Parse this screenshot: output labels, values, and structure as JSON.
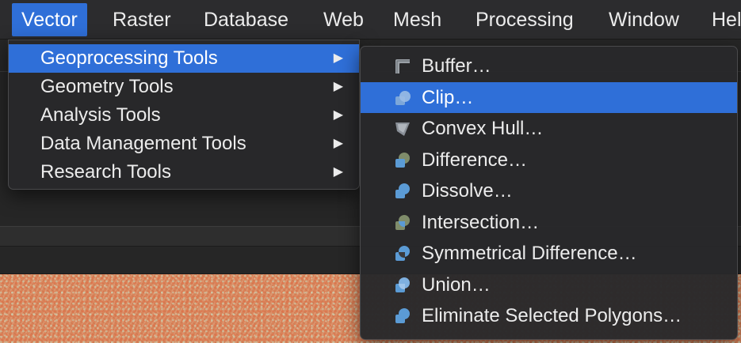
{
  "menubar": {
    "items": [
      {
        "label": "Vector",
        "active": true
      },
      {
        "label": "Raster"
      },
      {
        "label": "Database"
      },
      {
        "label": "Web"
      },
      {
        "label": "Mesh"
      },
      {
        "label": "Processing"
      },
      {
        "label": "Window"
      },
      {
        "label": "Hel"
      }
    ]
  },
  "vector_menu": {
    "items": [
      {
        "label": "Geoprocessing Tools",
        "has_submenu": true,
        "highlighted": true
      },
      {
        "label": "Geometry Tools",
        "has_submenu": true
      },
      {
        "label": "Analysis Tools",
        "has_submenu": true
      },
      {
        "label": "Data Management Tools",
        "has_submenu": true
      },
      {
        "label": "Research Tools",
        "has_submenu": true
      }
    ],
    "submenu_arrow": "▶"
  },
  "geoprocessing_submenu": {
    "items": [
      {
        "label": "Buffer…",
        "icon": "buffer-icon"
      },
      {
        "label": "Clip…",
        "icon": "clip-icon",
        "highlighted": true
      },
      {
        "label": "Convex Hull…",
        "icon": "convex-hull-icon"
      },
      {
        "label": "Difference…",
        "icon": "difference-icon"
      },
      {
        "label": "Dissolve…",
        "icon": "dissolve-icon"
      },
      {
        "label": "Intersection…",
        "icon": "intersection-icon"
      },
      {
        "label": "Symmetrical Difference…",
        "icon": "symmetrical-difference-icon"
      },
      {
        "label": "Union…",
        "icon": "union-icon"
      },
      {
        "label": "Eliminate Selected Polygons…",
        "icon": "eliminate-polygons-icon"
      }
    ]
  },
  "colors": {
    "highlight": "#2f6fd8",
    "menu_bg": "#28282a",
    "menu_text": "#ececec",
    "icon_blue": "#5b9bd5",
    "icon_gray": "#8a8f7a",
    "map_orange": "#d8845a"
  }
}
